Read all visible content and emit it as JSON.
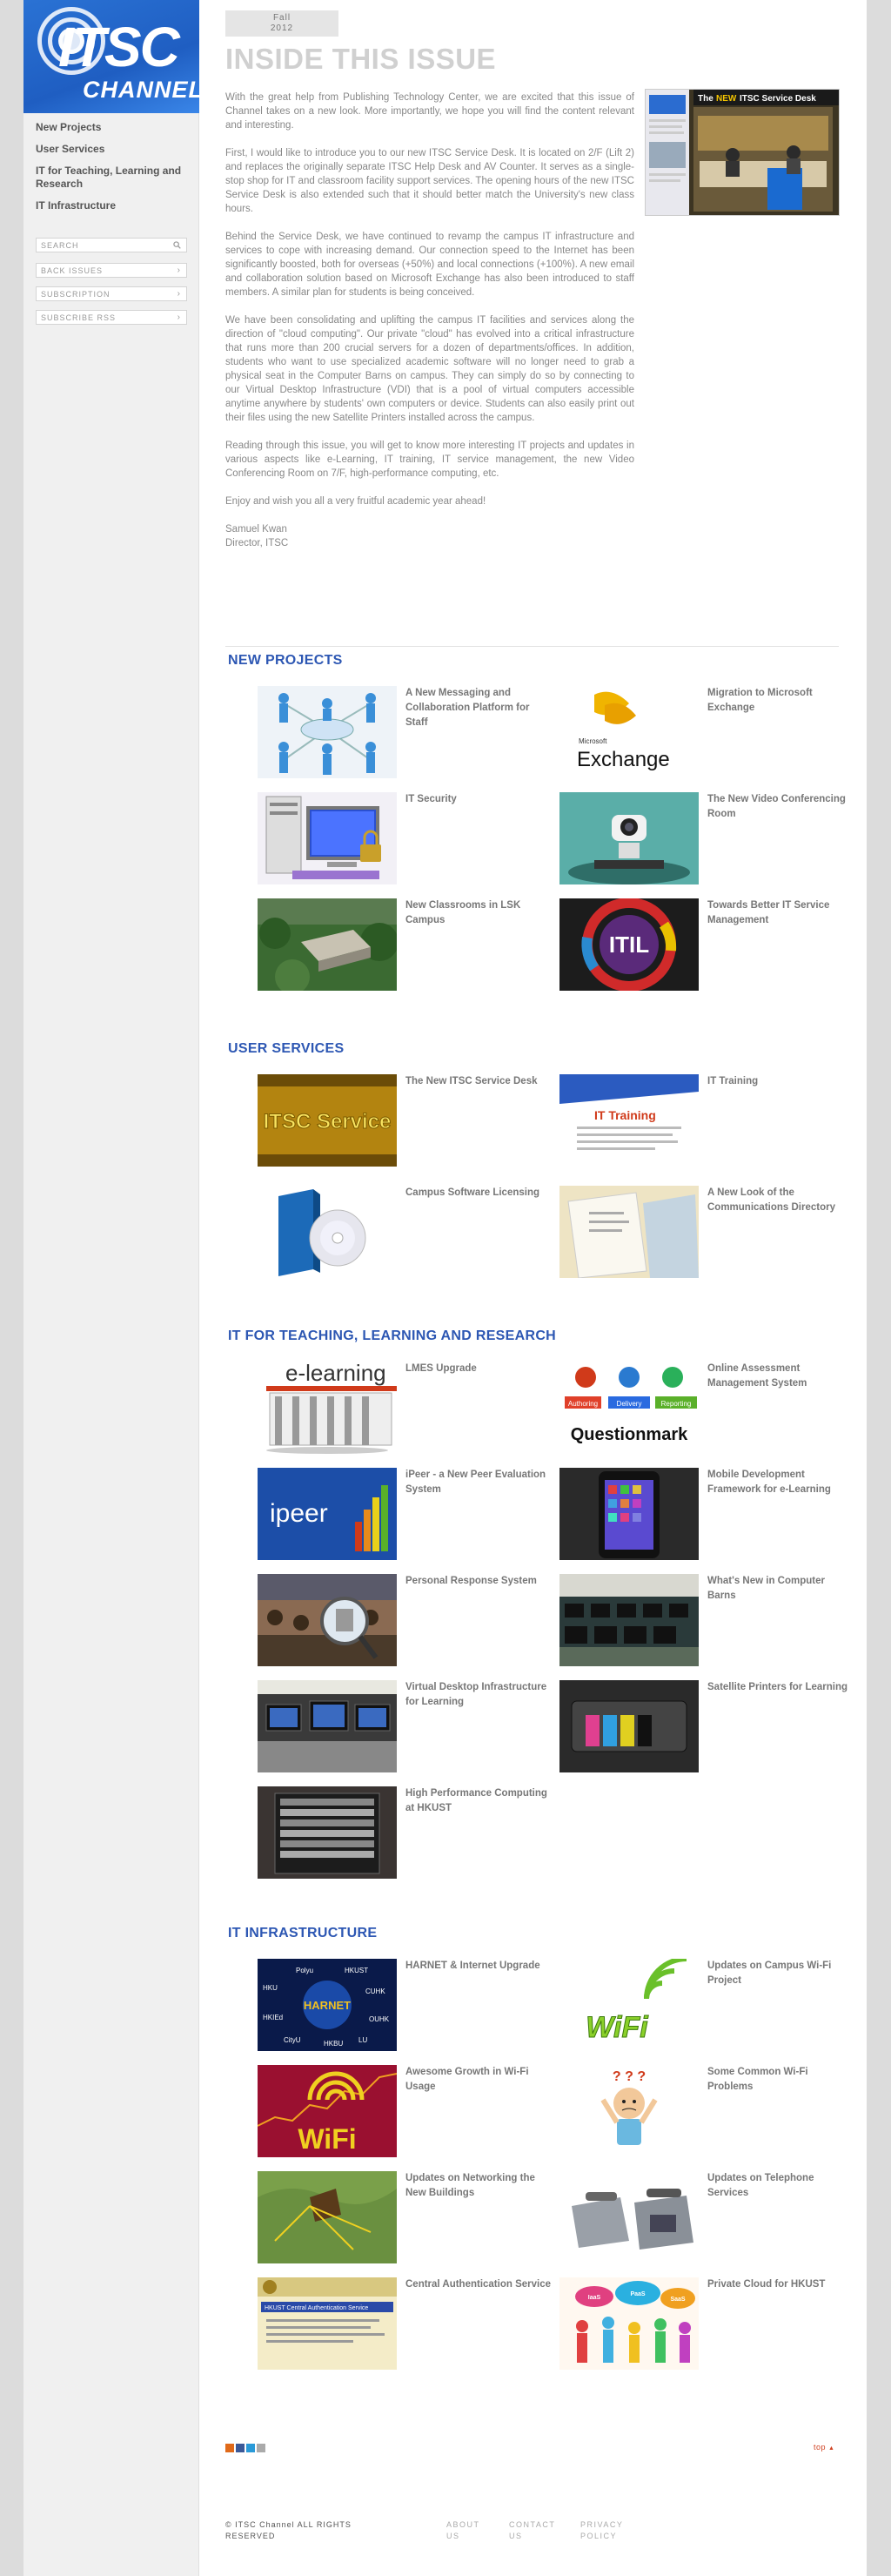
{
  "sidebar": {
    "logo": {
      "line1": "ITSC",
      "line2": "CHANNEL"
    },
    "nav": [
      "New Projects",
      "User Services",
      "IT for Teaching, Learning and Research",
      "IT Infrastructure"
    ],
    "search_placeholder": "SEARCH",
    "links": [
      "BACK ISSUES",
      "SUBSCRIPTION",
      "SUBSCRIBE RSS"
    ]
  },
  "issue": {
    "season": "Fall",
    "year": "2012"
  },
  "page_title": "INSIDE THIS ISSUE",
  "intro": [
    "With the great help from Publishing Technology Center, we are excited that this issue of Channel takes on a new look. More importantly, we hope you will find the content relevant and interesting.",
    "First, I would like to introduce you to our new ITSC Service Desk. It is located on 2/F (Lift 2) and replaces the originally separate ITSC Help Desk and AV Counter. It serves as a single-stop shop for IT and classroom facility support services. The opening hours of the new ITSC Service Desk is also extended such that it should better match the University's new class hours.",
    "Behind the Service Desk, we have continued to revamp the campus IT infrastructure and services to cope with increasing demand. Our connection speed to the Internet has been significantly boosted, both for overseas (+50%) and local connections (+100%). A new email and collaboration solution based on Microsoft Exchange has also been introduced to staff members. A similar plan for students is being conceived.",
    "We have been consolidating and uplifting the campus IT facilities and services along the direction of \"cloud computing\". Our private \"cloud\" has evolved into a critical infrastructure that runs more than 200 crucial servers for a dozen of departments/offices. In addition, students who want to use specialized academic software will no longer need to grab a physical seat in the Computer Barns on campus. They can simply do so by connecting to our Virtual Desktop Infrastructure (VDI) that is a pool of virtual computers accessible anytime anywhere by students' own computers or device. Students can also easily print out their files using the new Satellite Printers installed across the campus.",
    "Reading through this issue, you will get to know more interesting IT projects and updates in various aspects like e-Learning, IT training, IT service management, the new Video Conferencing Room on 7/F, high-performance computing, etc.",
    "Enjoy and wish you all a very fruitful academic year ahead!"
  ],
  "signature": {
    "name": "Samuel Kwan",
    "role": "Director, ITSC"
  },
  "hero_caption": {
    "the": "The",
    "new": "NEW",
    "rest": "ITSC Service Desk"
  },
  "sections": {
    "new_projects": {
      "title": "NEW PROJECTS",
      "items": [
        "A New Messaging and Collaboration Platform for Staff",
        "Migration to Microsoft Exchange",
        "IT Security",
        "The New Video Conferencing Room",
        "New Classrooms in LSK Campus",
        "Towards Better IT Service Management"
      ]
    },
    "user_services": {
      "title": "USER SERVICES",
      "items": [
        "The New ITSC Service Desk",
        "IT Training",
        "Campus Software Licensing",
        "A New Look of the Communications Directory"
      ]
    },
    "teaching": {
      "title": "IT FOR TEACHING, LEARNING AND RESEARCH",
      "items": [
        "LMES Upgrade",
        "Online Assessment Management System",
        "iPeer - a New Peer Evaluation System",
        "Mobile Development Framework for e-Learning",
        "Personal Response System",
        "What's New in Computer Barns",
        "Virtual Desktop Infrastructure for Learning",
        "Satellite Printers for Learning",
        "High Performance Computing at HKUST"
      ]
    },
    "infrastructure": {
      "title": "IT INFRASTRUCTURE",
      "items": [
        "HARNET & Internet Upgrade",
        "Updates on Campus Wi-Fi Project",
        "Awesome Growth in Wi-Fi Usage",
        "Some Common Wi-Fi Problems",
        "Updates on Networking the New Buildings",
        "Updates on Telephone Services",
        "Central Authentication Service",
        "Private Cloud for HKUST"
      ]
    }
  },
  "thumb_text": {
    "exchange_small": "Microsoft",
    "exchange_big": "Exchange",
    "itil": "ITIL",
    "itsc_service": "ITSC Service",
    "it_training": "IT Training",
    "elearning": "e-learning",
    "questionmark": "Questionmark",
    "qm_buttons": [
      "Authoring",
      "Delivery",
      "Reporting"
    ],
    "ipeer": "ipeer",
    "harnet": "HARNET",
    "harnet_nodes": [
      "Polyu",
      "HKUST",
      "HKU",
      "CUHK",
      "HKIEd",
      "OUHK",
      "CityU",
      "HKBU",
      "LU"
    ],
    "wifi": "WiFi",
    "q_marks": "? ? ?",
    "cas_title": "HKUST Central Authentication Service",
    "cloud_words": [
      "IaaS",
      "PaaS",
      "SaaS"
    ]
  },
  "footer": {
    "copyright": "© ITSC Channel   ALL RIGHTS RESERVED",
    "links": [
      "ABOUT US",
      "CONTACT US",
      "PRIVACY POLICY"
    ],
    "top": "top"
  }
}
